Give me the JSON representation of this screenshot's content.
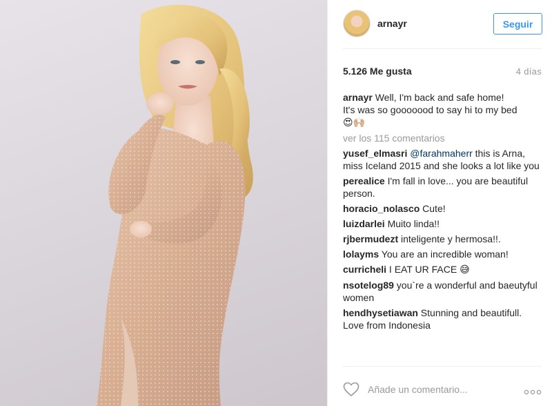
{
  "post": {
    "image_alt": "Woman with long blonde wavy hair in a rose-gold sequined long-sleeve wrap dress against a grey backdrop"
  },
  "header": {
    "username": "arnayr",
    "follow_label": "Seguir"
  },
  "stats": {
    "likes": "5.126 Me gusta",
    "time": "4 días"
  },
  "caption": {
    "user": "arnayr",
    "line1": "Well, I'm back and safe home!",
    "line2": "It's was so gooooood to say hi to my bed",
    "emoji": "😍🙌🏼"
  },
  "view_more": "ver los 115 comentarios",
  "comments": [
    {
      "user": "yusef_elmasri",
      "mention": "@farahmaherr",
      "text": " this is Arna, miss Iceland 2015 and she looks a lot like you"
    },
    {
      "user": "perealice",
      "text": " I'm fall in love... you are beautiful person."
    },
    {
      "user": "horacio_nolasco",
      "text": " Cute!"
    },
    {
      "user": "luizdarlei",
      "text": " Muito linda!!"
    },
    {
      "user": "rjbermudezt",
      "text": " inteligente y hermosa!!."
    },
    {
      "user": "lolayms",
      "text": " You are an incredible woman!"
    },
    {
      "user": "curricheli",
      "text": " I EAT UR FACE ",
      "emoji": "😅"
    },
    {
      "user": "nsotelog89",
      "text": " you`re a wonderful and baeutyful women"
    },
    {
      "user": "hendhysetiawan",
      "text": " Stunning and beautifull. Love from Indonesia"
    }
  ],
  "footer": {
    "placeholder": "Añade un comentario...",
    "icons": [
      "heart-icon",
      "more-options-icon"
    ]
  },
  "colors": {
    "accent": "#3897f0",
    "text": "#262626",
    "muted": "#999999",
    "mention": "#003569",
    "divider": "#efefef"
  }
}
